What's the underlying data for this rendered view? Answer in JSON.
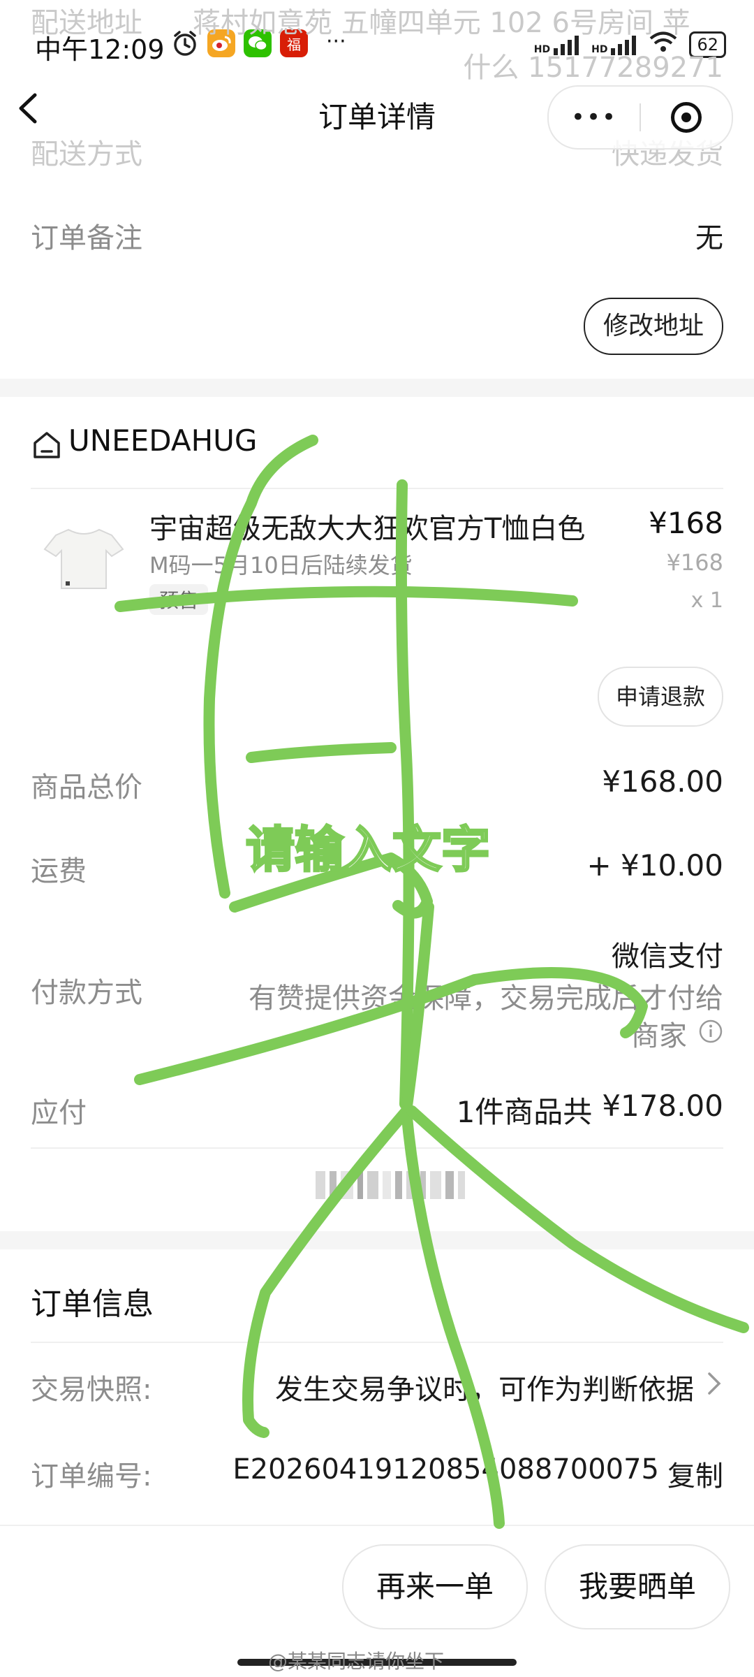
{
  "colors": {
    "accent_green": "#7ecb57",
    "page_bg": "#ffffff",
    "section_gap": "#f5f5f5",
    "app_weibo": "#f5a623",
    "app_wechat": "#2dc100",
    "app_fu": "#d81e06"
  },
  "status_bar": {
    "time": "中午12:09",
    "battery": "62",
    "icons": [
      "alarm-icon",
      "weibo-icon",
      "wechat-icon",
      "fu-icon",
      "more-icon"
    ],
    "right_icons": [
      "hd-signal-icon",
      "hd-signal-icon",
      "wifi-icon",
      "battery-icon"
    ],
    "more": "···",
    "fu_char": "福",
    "hd1": "HD",
    "hd2": "HD"
  },
  "nav": {
    "title": "订单详情",
    "more": "•••"
  },
  "faded_top": {
    "addr_label": "配送地址",
    "addr_value": "蒋村如意苑 五幢四单元 102 6号房间 苹",
    "addr_line2": "什么 15177289271",
    "delivery_label": "配送方式",
    "delivery_value": "快递发货"
  },
  "order_note": {
    "label": "订单备注",
    "value": "无"
  },
  "modify_address": "修改地址",
  "shop": {
    "name": "UNEEDAHUG"
  },
  "product": {
    "name": "宇宙超级无敌大大狂欢官方T恤白色",
    "price": "¥168",
    "original_price": "¥168",
    "spec": "M码一5月10日后陆续发货",
    "quantity": "x 1",
    "tag": "预售",
    "refund": "申请退款"
  },
  "summary": {
    "goods_total_label": "商品总价",
    "goods_total": "¥168.00",
    "shipping_label": "运费",
    "shipping": "+ ¥10.00",
    "payment_label": "付款方式",
    "payment_method": "微信支付",
    "payment_note_1": "有赞提供资金保障，交易完成后才付给",
    "payment_note_2": "商家",
    "payable_label": "应付",
    "payable_count": "1件商品共",
    "payable_amount": "¥178.00"
  },
  "overlay_text": "请输入文字",
  "order_info": {
    "title": "订单信息",
    "snapshot_label": "交易快照:",
    "snapshot_value": "发生交易争议时，可作为判断依据",
    "number_label": "订单编号:",
    "number_value": "E20260419120854088700075",
    "copy": "复制"
  },
  "bottom_actions": {
    "reorder": "再来一单",
    "share": "我要晒单"
  },
  "watermark": "@某某同志请你坐下"
}
